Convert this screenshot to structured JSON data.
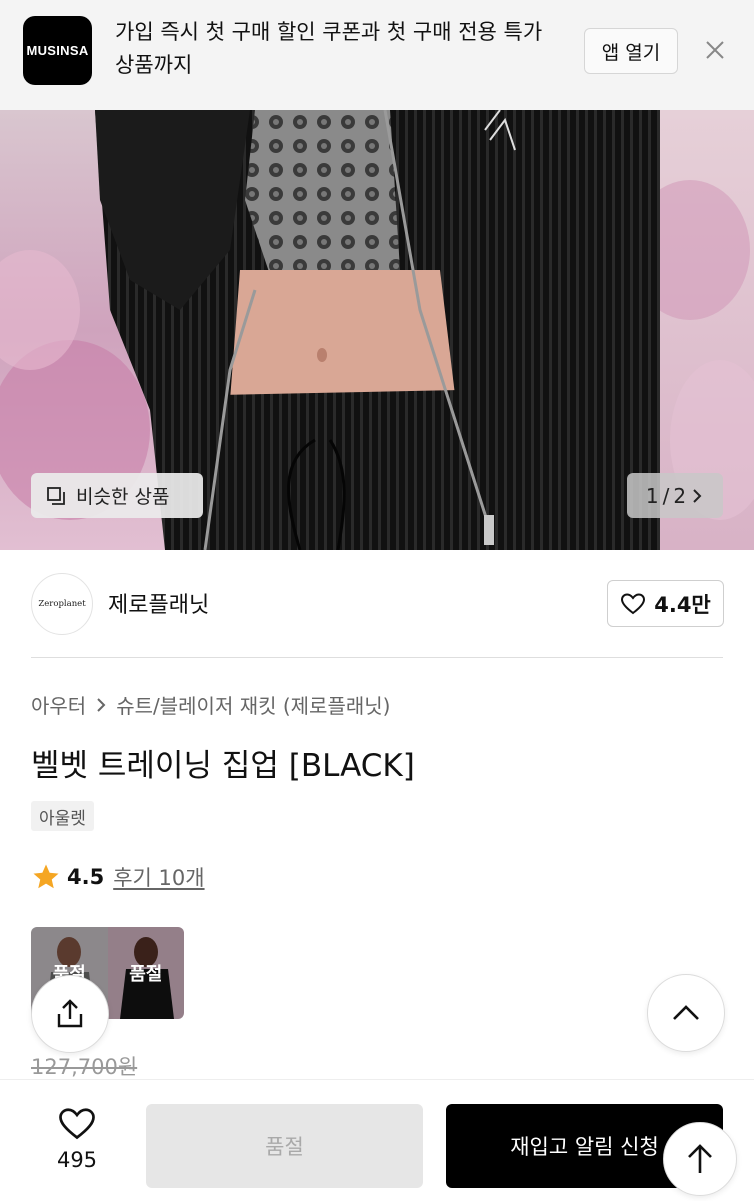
{
  "banner": {
    "logo_text": "MUSINSA",
    "promo_text": "가입 즉시 첫 구매 할인 쿠폰과 첫 구매 전용 특가 상품까지",
    "open_app_label": "앱 열기",
    "close_icon": "close-icon"
  },
  "gallery": {
    "similar_label": "비슷한 상품",
    "page_current": "1",
    "page_separator": "/",
    "page_total": "2"
  },
  "brand": {
    "logo_text": "Zeroplanet",
    "name": "제로플래닛",
    "like_count": "4.4만"
  },
  "product": {
    "breadcrumb": [
      "아우터",
      "슈트/블레이저 재킷 (제로플래닛)"
    ],
    "title": "벨벳 트레이닝 집업 [BLACK]",
    "tag": "아울렛",
    "rating": "4.5",
    "review_label": "후기 10개",
    "thumbnails": [
      {
        "label": "품절"
      },
      {
        "label": "품절"
      }
    ],
    "original_price": "127,700원"
  },
  "bottom_bar": {
    "wish_count": "495",
    "soldout_label": "품절",
    "restock_label": "재입고 알림 신청"
  },
  "colors": {
    "accent_star": "#F5A623",
    "primary_button": "#000000",
    "disabled_button": "#E6E6E6"
  }
}
